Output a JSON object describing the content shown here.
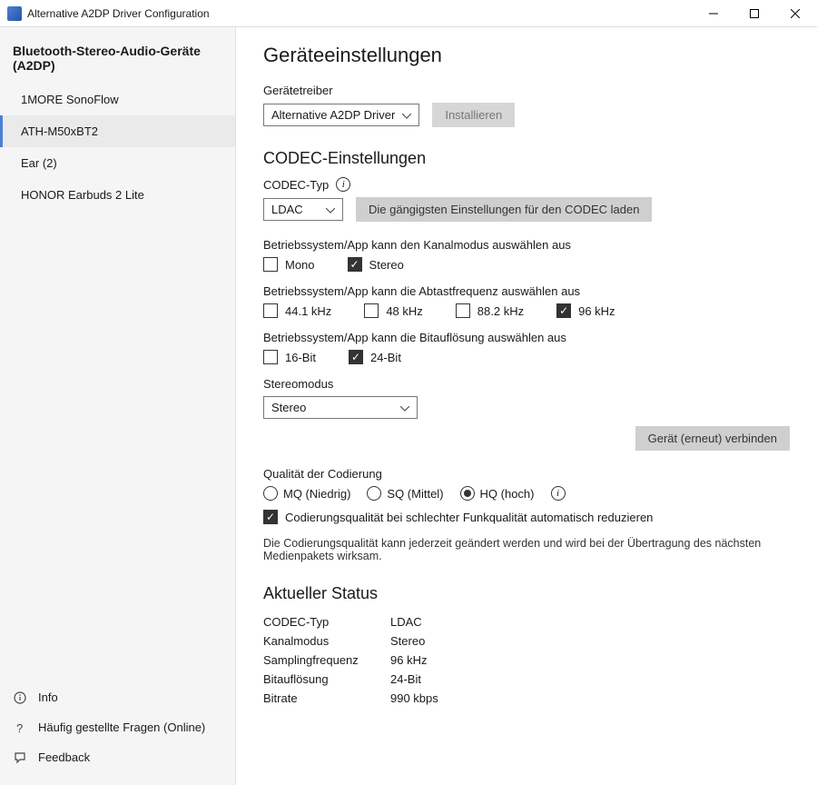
{
  "title": "Alternative A2DP Driver Configuration",
  "sidebar": {
    "header": "Bluetooth-Stereo-Audio-Geräte (A2DP)",
    "devices": [
      "1MORE SonoFlow",
      "ATH-M50xBT2",
      "Ear (2)",
      "HONOR Earbuds 2 Lite"
    ],
    "bottom": {
      "info": "Info",
      "faq": "Häufig gestellte Fragen (Online)",
      "feedback": "Feedback"
    }
  },
  "settings": {
    "heading": "Geräteeinstellungen",
    "driver_label": "Gerätetreiber",
    "driver_value": "Alternative A2DP Driver",
    "install": "Installieren",
    "codec_heading": "CODEC-Einstellungen",
    "codec_type_label": "CODEC-Typ",
    "codec_value": "LDAC",
    "load_defaults": "Die gängigsten Einstellungen für den CODEC laden",
    "channel_label": "Betriebssystem/App kann den Kanalmodus auswählen aus",
    "ch_mono": "Mono",
    "ch_stereo": "Stereo",
    "freq_label": "Betriebssystem/App kann die Abtastfrequenz auswählen aus",
    "f44": "44.1 kHz",
    "f48": "48 kHz",
    "f88": "88.2 kHz",
    "f96": "96 kHz",
    "bits_label": "Betriebssystem/App kann die Bitauflösung auswählen aus",
    "b16": "16-Bit",
    "b24": "24-Bit",
    "stereo_mode_label": "Stereomodus",
    "stereo_mode_value": "Stereo",
    "reconnect": "Gerät (erneut) verbinden",
    "quality_label": "Qualität der Codierung",
    "q_mq": "MQ (Niedrig)",
    "q_sq": "SQ (Mittel)",
    "q_hq": "HQ (hoch)",
    "auto_reduce": "Codierungsqualität bei schlechter Funkqualität automatisch reduzieren",
    "quality_note": "Die Codierungsqualität kann jederzeit geändert werden und wird bei der Übertragung des nächsten Medienpakets wirksam."
  },
  "status": {
    "heading": "Aktueller Status",
    "codec_k": "CODEC-Typ",
    "codec_v": "LDAC",
    "chan_k": "Kanalmodus",
    "chan_v": "Stereo",
    "freq_k": "Samplingfrequenz",
    "freq_v": "96 kHz",
    "bits_k": "Bitauflösung",
    "bits_v": "24-Bit",
    "rate_k": "Bitrate",
    "rate_v": "990 kbps"
  }
}
